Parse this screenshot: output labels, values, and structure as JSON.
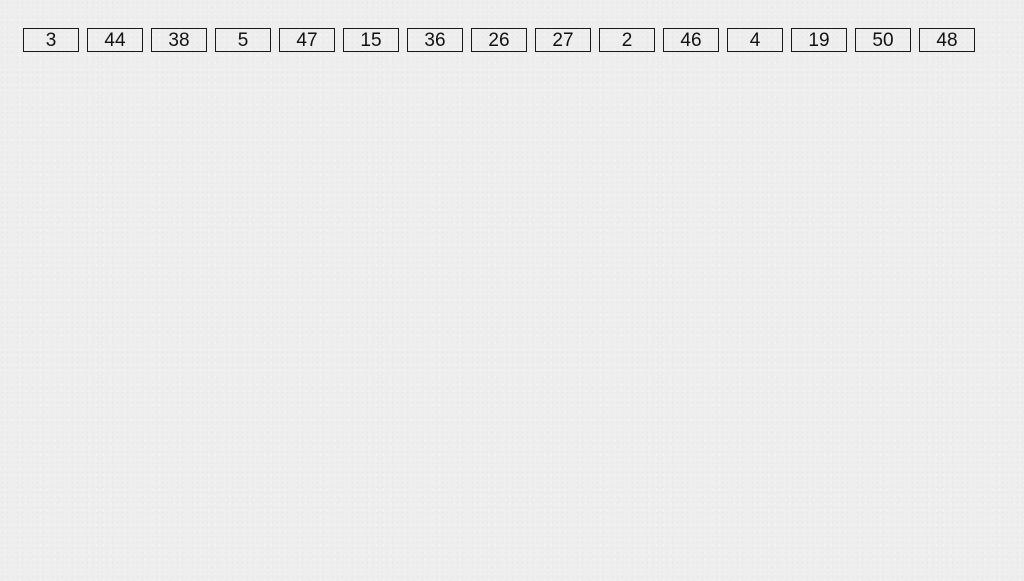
{
  "boxes": [
    {
      "label": "3"
    },
    {
      "label": "44"
    },
    {
      "label": "38"
    },
    {
      "label": "5"
    },
    {
      "label": "47"
    },
    {
      "label": "15"
    },
    {
      "label": "36"
    },
    {
      "label": "26"
    },
    {
      "label": "27"
    },
    {
      "label": "2"
    },
    {
      "label": "46"
    },
    {
      "label": "4"
    },
    {
      "label": "19"
    },
    {
      "label": "50"
    },
    {
      "label": "48"
    }
  ],
  "colors": {
    "background": "#eeeeee",
    "border": "#1a1a1a",
    "text": "#111111"
  }
}
